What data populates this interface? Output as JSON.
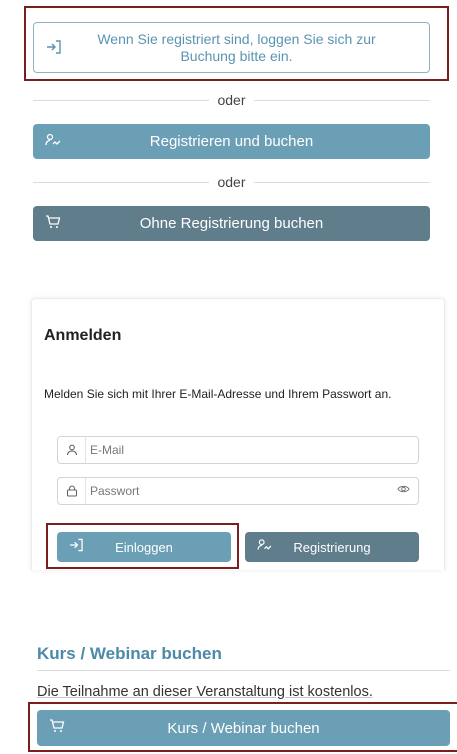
{
  "login_hint": {
    "icon": "login-arrow-icon",
    "text": "Wenn Sie registriert sind, loggen Sie sich zur Buchung bitte ein."
  },
  "divider_text": "oder",
  "register_and_book": {
    "icon": "signature-icon",
    "label": "Registrieren und buchen"
  },
  "divider_text_2": "oder",
  "book_without_registration": {
    "icon": "cart-icon",
    "label": "Ohne Registrierung buchen"
  },
  "login_card": {
    "title": "Anmelden",
    "description": "Melden Sie sich mit Ihrer E-Mail-Adresse und Ihrem Passwort an.",
    "email": {
      "icon": "user-icon",
      "placeholder": "E-Mail",
      "value": ""
    },
    "password": {
      "icon": "lock-icon",
      "placeholder": "Passwort",
      "value": "",
      "toggle_icon": "eye-icon"
    },
    "login_button": {
      "icon": "login-arrow-icon",
      "label": "Einloggen"
    },
    "register_button": {
      "icon": "signature-icon",
      "label": "Registrierung"
    }
  },
  "booking": {
    "title": "Kurs / Webinar buchen",
    "free_text": "Die Teilnahme an dieser Veranstaltung ist kostenlos.",
    "book_button": {
      "icon": "cart-icon",
      "label": "Kurs / Webinar buchen"
    }
  },
  "colors": {
    "accent_blue": "#6b9fb6",
    "slate": "#5f7d8a",
    "highlight_frame": "#7a1f1f",
    "heading_blue": "#4b8aa8"
  }
}
